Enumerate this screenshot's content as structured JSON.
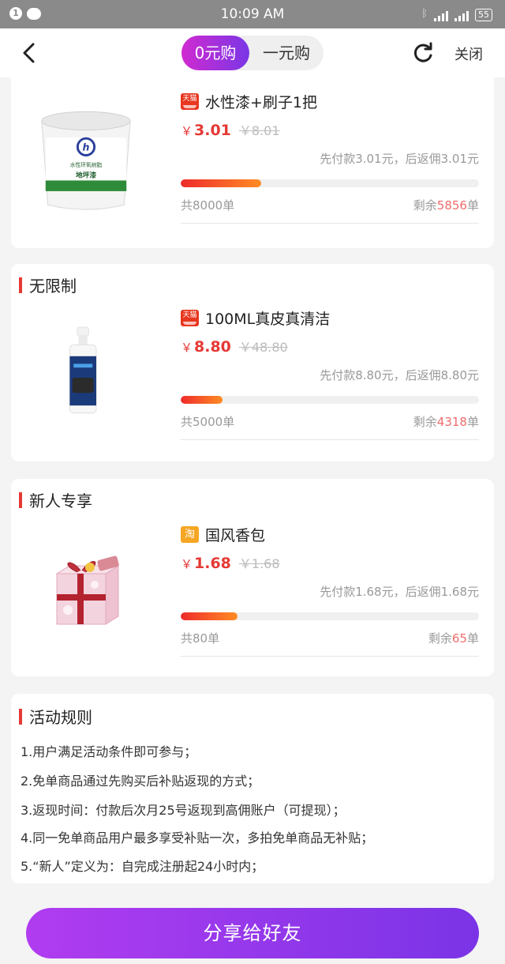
{
  "status_bar": {
    "time": "10:09 AM",
    "notification_count": "1",
    "battery": "55"
  },
  "nav": {
    "tab_active": "0元购",
    "tab_inactive": "一元购",
    "close_label": "关闭"
  },
  "products": [
    {
      "section_title": "",
      "platform": "tmall",
      "platform_label": "天猫",
      "name": "水性漆+刷子1把",
      "currency": "￥",
      "price": "3.01",
      "original_price": "￥8.01",
      "rebate": "先付款3.01元，后返佣3.01元",
      "total": "共8000单",
      "remain_prefix": "剩余",
      "remain_count": "5856",
      "remain_suffix": "单",
      "progress": 0.27,
      "image_labels": [
        "水性环氧树脂",
        "地坪漆"
      ]
    },
    {
      "section_title": "无限制",
      "platform": "tmall",
      "platform_label": "天猫",
      "name": "100ML真皮真清洁",
      "currency": "￥",
      "price": "8.80",
      "original_price": "￥48.80",
      "rebate": "先付款8.80元，后返佣8.80元",
      "total": "共5000单",
      "remain_prefix": "剩余",
      "remain_count": "4318",
      "remain_suffix": "单",
      "progress": 0.14
    },
    {
      "section_title": "新人专享",
      "platform": "taobao",
      "platform_label": "淘",
      "name": "国风香包",
      "currency": "￥",
      "price": "1.68",
      "original_price": "￥1.68",
      "rebate": "先付款1.68元，后返佣1.68元",
      "total": "共80单",
      "remain_prefix": "剩余",
      "remain_count": "65",
      "remain_suffix": "单",
      "progress": 0.19
    }
  ],
  "rules": {
    "title": "活动规则",
    "items": [
      "1.用户满足活动条件即可参与；",
      "2.免单商品通过先购买后补贴返现的方式；",
      "3.返现时间：付款后次月25号返现到高佣账户（可提现）；",
      "4.同一免单商品用户最多享受补贴一次，多拍免单商品无补贴；",
      "5.“新人”定义为：自完成注册起24小时内；"
    ]
  },
  "share_label": "分享给好友",
  "colors": {
    "accent": "#e53935",
    "gradient_start": "#b13cf0",
    "gradient_end": "#7a34e6",
    "progress_start": "#ee2b2b",
    "progress_end": "#ff8c25"
  }
}
